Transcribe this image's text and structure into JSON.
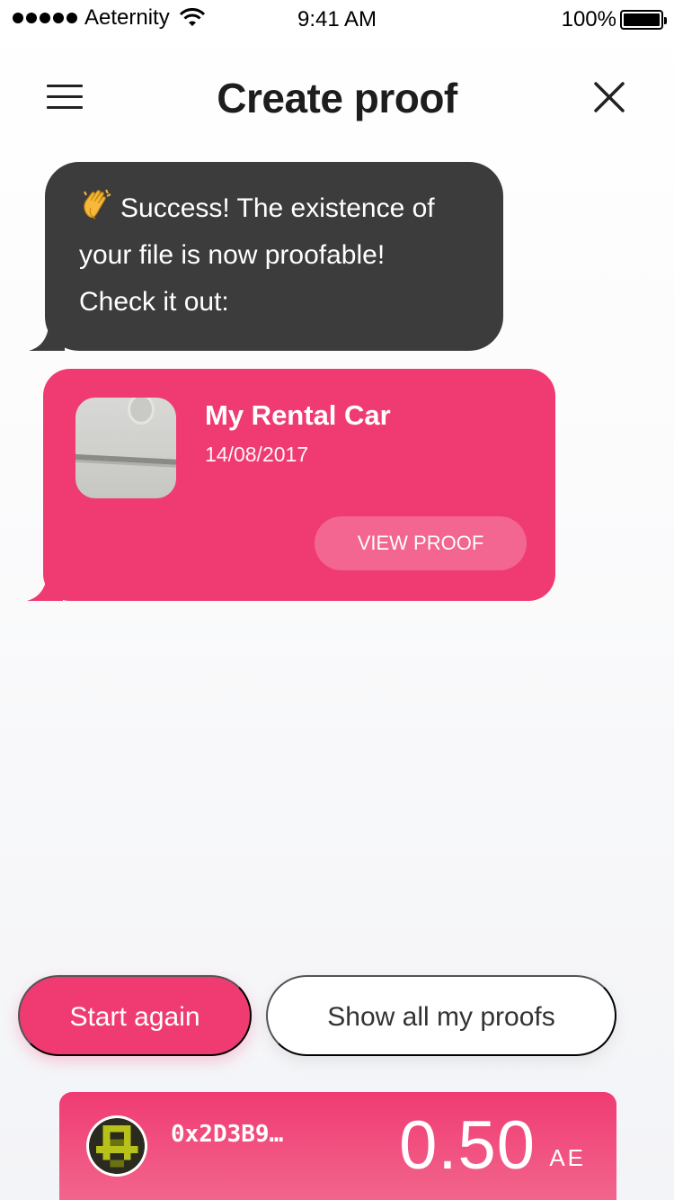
{
  "status_bar": {
    "carrier": "Aeternity",
    "time": "9:41 AM",
    "battery": "100%"
  },
  "header": {
    "title": "Create proof",
    "menu_icon": "hamburger-menu-icon",
    "close_icon": "close-icon"
  },
  "message": {
    "icon": "clapping-hands-icon",
    "line1": "Success! The existence of",
    "line2": "your file is now proofable!",
    "line3": "Check it out:"
  },
  "proof": {
    "title": "My Rental Car",
    "date": "14/08/2017",
    "view_label": "VIEW PROOF"
  },
  "actions": {
    "start_again": "Start again",
    "show_all": "Show all my proofs"
  },
  "wallet": {
    "address": "0x2D3B9…",
    "balance": "0.50",
    "unit": "AE"
  },
  "colors": {
    "accent": "#f03b72",
    "bubble": "#3c3c3c",
    "title": "#1d1d1d"
  }
}
